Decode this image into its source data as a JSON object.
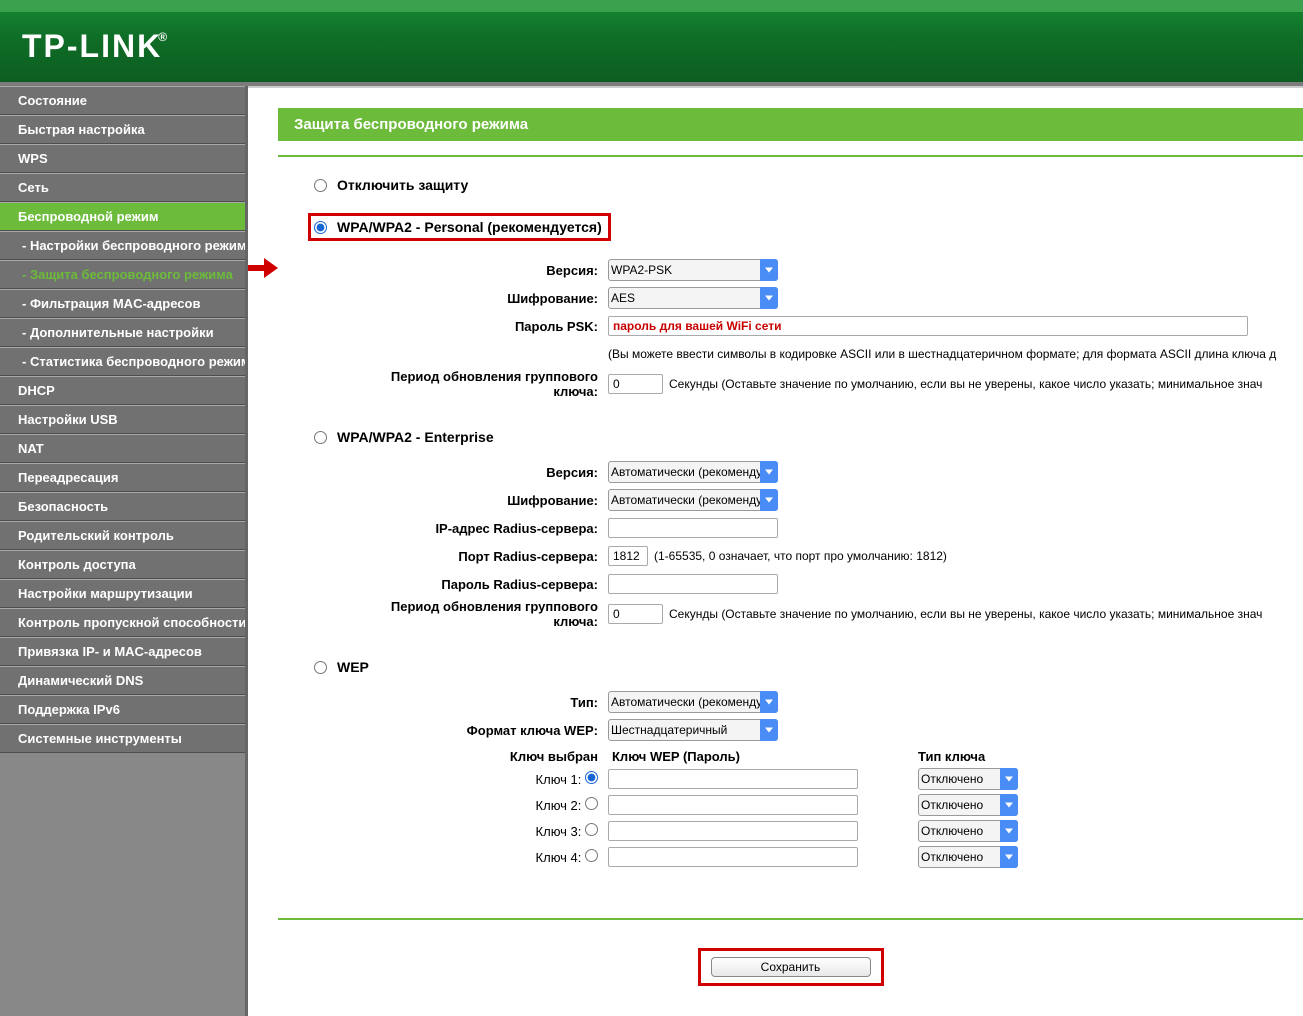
{
  "logo": "TP-LINK",
  "sidebar": {
    "items": [
      {
        "label": "Состояние"
      },
      {
        "label": "Быстрая настройка"
      },
      {
        "label": "WPS"
      },
      {
        "label": "Сеть"
      },
      {
        "label": "Беспроводной режим",
        "selectedParent": true
      },
      {
        "label": "- Настройки беспроводного режима",
        "sub": true
      },
      {
        "label": "- Защита беспроводного режима",
        "sub": true,
        "selected": true
      },
      {
        "label": "- Фильтрация MAC-адресов",
        "sub": true
      },
      {
        "label": "- Дополнительные настройки",
        "sub": true
      },
      {
        "label": "- Статистика беспроводного режима",
        "sub": true
      },
      {
        "label": "DHCP"
      },
      {
        "label": "Настройки USB"
      },
      {
        "label": "NAT"
      },
      {
        "label": "Переадресация"
      },
      {
        "label": "Безопасность"
      },
      {
        "label": "Родительский контроль"
      },
      {
        "label": "Контроль доступа"
      },
      {
        "label": "Настройки маршрутизации"
      },
      {
        "label": "Контроль пропускной способности"
      },
      {
        "label": "Привязка IP- и MAC-адресов"
      },
      {
        "label": "Динамический DNS"
      },
      {
        "label": "Поддержка IPv6"
      },
      {
        "label": "Системные инструменты"
      }
    ]
  },
  "page_title": "Защита беспроводного режима",
  "sections": {
    "disable": {
      "label": "Отключить защиту"
    },
    "personal": {
      "label": "WPA/WPA2 - Personal (рекомендуется)",
      "version_label": "Версия:",
      "version_value": "WPA2-PSK",
      "enc_label": "Шифрование:",
      "enc_value": "AES",
      "psk_label": "Пароль PSK:",
      "psk_hint": "пароль для вашей WiFi сети",
      "psk_note": "(Вы можете ввести символы в кодировке ASCII или в шестнадцатеричном формате; для формата ASCII длина ключа д",
      "gk_label": "Период обновления группового ключа:",
      "gk_value": "0",
      "gk_hint": "Секунды (Оставьте значение по умолчанию, если вы не уверены, какое число указать; минимальное знач"
    },
    "enterprise": {
      "label": "WPA/WPA2 - Enterprise",
      "version_label": "Версия:",
      "version_value": "Автоматически (рекоменду",
      "enc_label": "Шифрование:",
      "enc_value": "Автоматически (рекоменду",
      "radius_ip_label": "IP-адрес Radius-сервера:",
      "radius_port_label": "Порт Radius-сервера:",
      "radius_port_value": "1812",
      "radius_port_hint": "(1-65535, 0 означает, что порт про умолчанию: 1812)",
      "radius_pw_label": "Пароль Radius-сервера:",
      "gk_label": "Период обновления группового ключа:",
      "gk_value": "0",
      "gk_hint": "Секунды (Оставьте значение по умолчанию, если вы не уверены, какое число указать; минимальное знач"
    },
    "wep": {
      "label": "WEP",
      "type_label": "Тип:",
      "type_value": "Автоматически (рекоменду",
      "format_label": "Формат ключа WEP:",
      "format_value": "Шестнадцатеричный",
      "header_col1": "Ключ выбран",
      "header_col2": "Ключ WEP (Пароль)",
      "header_col3": "Тип ключа",
      "keys": [
        {
          "label": "Ключ 1:",
          "type": "Отключено"
        },
        {
          "label": "Ключ 2:",
          "type": "Отключено"
        },
        {
          "label": "Ключ 3:",
          "type": "Отключено"
        },
        {
          "label": "Ключ 4:",
          "type": "Отключено"
        }
      ]
    }
  },
  "save_label": "Сохранить"
}
